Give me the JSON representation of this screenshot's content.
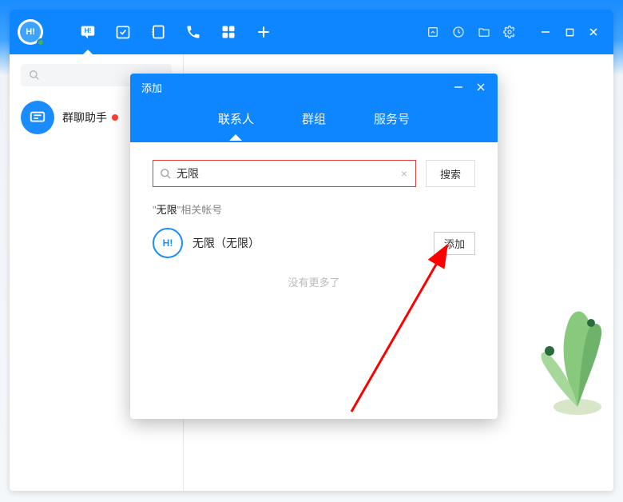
{
  "profile_badge": "H!",
  "sidebar": {
    "chat_items": [
      {
        "title": "群聊助手"
      }
    ]
  },
  "modal": {
    "title": "添加",
    "tabs": [
      {
        "id": "contact",
        "label": "联系人",
        "active": true
      },
      {
        "id": "group",
        "label": "群组",
        "active": false
      },
      {
        "id": "service",
        "label": "服务号",
        "active": false
      }
    ],
    "search_value": "无限",
    "search_button": "搜索",
    "hint_quoted": "无限",
    "hint_suffix": "相关帐号",
    "result_name": "无限（无限）",
    "result_badge": "H!",
    "add_button": "添加",
    "no_more": "没有更多了"
  }
}
